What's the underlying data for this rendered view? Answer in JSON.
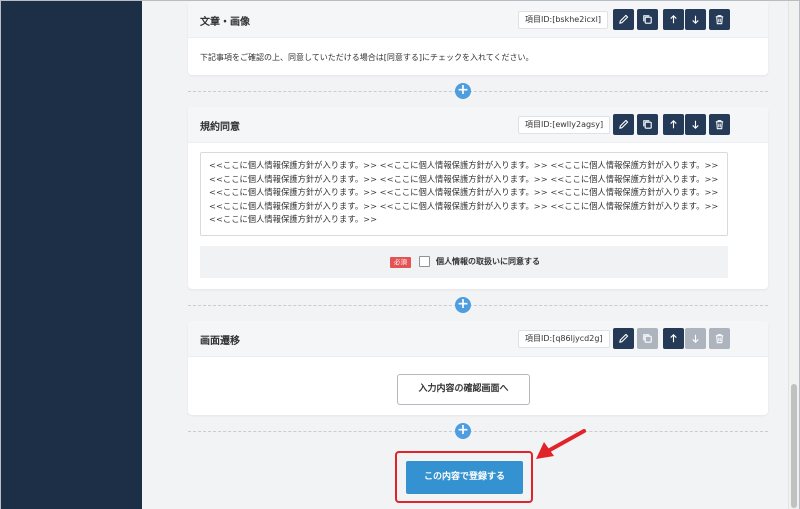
{
  "blocks": [
    {
      "title": "文章・画像",
      "item_id": "項目ID:[bskhe2icxl]",
      "description": "下記事項をご確認の上、同意していただける場合は[同意する]にチェックを入れてください。"
    },
    {
      "title": "規約同意",
      "item_id": "項目ID:[ewlly2agsy]",
      "policy_text": "<<ここに個人情報保護方針が入ります。>> <<ここに個人情報保護方針が入ります。>> <<ここに個人情報保護方針が入ります。>> <<ここに個人情報保護方針が入ります。>> <<ここに個人情報保護方針が入ります。>> <<ここに個人情報保護方針が入ります。>><<ここに個人情報保護方針が入ります。>> <<ここに個人情報保護方針が入ります。>> <<ここに個人情報保護方針が入ります。>> <<ここに個人情報保護方針が入ります。>> <<ここに個人情報保護方針が入ります。>> <<ここに個人情報保護方針が入ります。>> <<ここに個人情報保護方針が入ります。>>",
      "required_label": "必須",
      "consent_label": "個人情報の取扱いに同意する",
      "consent_checked": false
    },
    {
      "title": "画面遷移",
      "item_id": "項目ID:[q86ljycd2g]",
      "confirm_button": "入力内容の確認画面へ"
    }
  ],
  "add_symbol": "+",
  "register_button": "この内容で登録する",
  "icons": [
    "pencil-icon",
    "copy-icon",
    "arrow-up-icon",
    "arrow-down-icon",
    "trash-icon",
    "plus-icon"
  ],
  "colors": {
    "sidebar": "#1c2f47",
    "icon_button": "#243a56",
    "icon_button_disabled": "#aeb4bd",
    "add_button": "#4d9de0",
    "register_button": "#3592d0",
    "required_badge": "#e35353",
    "highlight": "#e0242a"
  }
}
